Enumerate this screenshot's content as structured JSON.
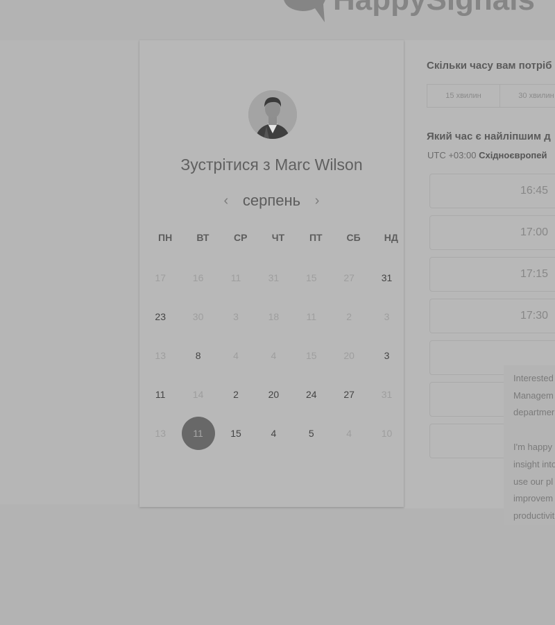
{
  "brand": {
    "name": "HappySignals"
  },
  "booking": {
    "heading": "Зустрітися з Marc Wilson",
    "month": "серпень",
    "prev_icon": "chevron-left-icon",
    "next_icon": "chevron-right-icon",
    "weekdays": [
      "ПН",
      "ВТ",
      "СР",
      "ЧТ",
      "ПТ",
      "СБ",
      "НД"
    ],
    "weeks": [
      [
        {
          "d": "17",
          "on": false
        },
        {
          "d": "16",
          "on": false
        },
        {
          "d": "11",
          "on": false
        },
        {
          "d": "31",
          "on": false
        },
        {
          "d": "15",
          "on": false
        },
        {
          "d": "27",
          "on": false
        },
        {
          "d": "31",
          "on": true
        }
      ],
      [
        {
          "d": "23",
          "on": true
        },
        {
          "d": "30",
          "on": false
        },
        {
          "d": "3",
          "on": false
        },
        {
          "d": "18",
          "on": false
        },
        {
          "d": "11",
          "on": false
        },
        {
          "d": "2",
          "on": false
        },
        {
          "d": "3",
          "on": false
        }
      ],
      [
        {
          "d": "13",
          "on": false
        },
        {
          "d": "8",
          "on": true
        },
        {
          "d": "4",
          "on": false
        },
        {
          "d": "4",
          "on": false
        },
        {
          "d": "15",
          "on": false
        },
        {
          "d": "20",
          "on": false
        },
        {
          "d": "3",
          "on": true
        }
      ],
      [
        {
          "d": "11",
          "on": true
        },
        {
          "d": "14",
          "on": false
        },
        {
          "d": "2",
          "on": true
        },
        {
          "d": "20",
          "on": true
        },
        {
          "d": "24",
          "on": true
        },
        {
          "d": "27",
          "on": true
        },
        {
          "d": "31",
          "on": false
        }
      ],
      [
        {
          "d": "13",
          "on": false
        },
        {
          "d": "11",
          "on": true,
          "selected": true
        },
        {
          "d": "15",
          "on": true
        },
        {
          "d": "4",
          "on": true
        },
        {
          "d": "5",
          "on": true
        },
        {
          "d": "4",
          "on": false
        },
        {
          "d": "10",
          "on": false
        }
      ]
    ]
  },
  "scheduler": {
    "duration_question": "Скільки часу вам потріб",
    "durations": [
      "15 хвилин",
      "30 хвилин"
    ],
    "time_question": "Який час є найліпшим д",
    "timezone_offset": "UTC +03:00",
    "timezone_name": "Східноєвропей",
    "slots": [
      "16:45",
      "17:00",
      "17:15",
      "17:30",
      "",
      "",
      ""
    ]
  },
  "chat": {
    "lines_1": [
      "Interested",
      "Managem",
      "departmer"
    ],
    "lines_2": [
      "I'm happy",
      "insight into",
      "use our pl",
      "improvem",
      "productivit"
    ]
  },
  "colors": {
    "background": "#b3b3b3",
    "selected_day": "#686868"
  }
}
